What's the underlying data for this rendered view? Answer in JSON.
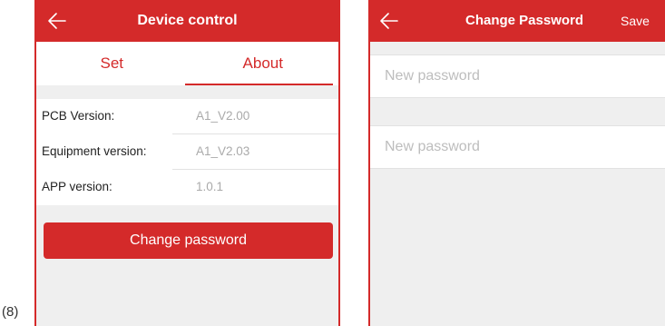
{
  "figure_label": "(8)",
  "device_control": {
    "title": "Device control",
    "tabs": [
      {
        "label": "Set",
        "active": false
      },
      {
        "label": "About",
        "active": true
      }
    ],
    "info": [
      {
        "label": "PCB Version:",
        "value": "A1_V2.00"
      },
      {
        "label": "Equipment version:",
        "value": "A1_V2.03"
      },
      {
        "label": "APP version:",
        "value": "1.0.1"
      }
    ],
    "change_password_button": "Change password"
  },
  "change_password": {
    "title": "Change Password",
    "save_label": "Save",
    "fields": [
      {
        "placeholder": "New password",
        "value": ""
      },
      {
        "placeholder": "New password",
        "value": ""
      }
    ]
  },
  "colors": {
    "accent": "#d42a2a",
    "background": "#efefef",
    "muted_text": "#aaaaaa"
  },
  "icons": {
    "back": "arrow-left-icon"
  }
}
